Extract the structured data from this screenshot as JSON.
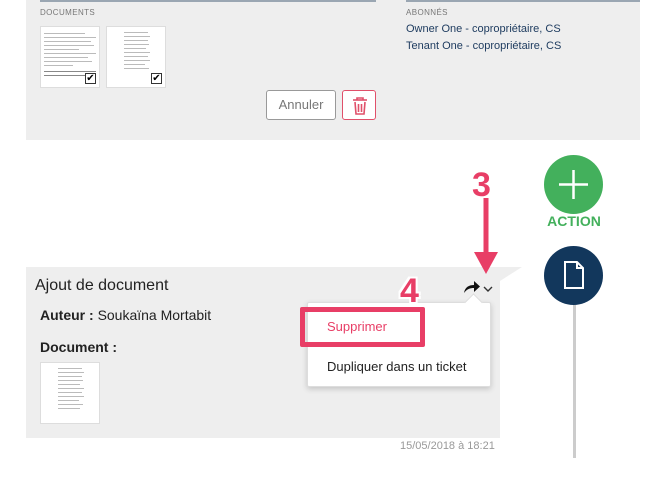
{
  "top_card": {
    "documents_label": "DOCUMENTS",
    "subscribers_label": "ABONNÉS",
    "subscribers": [
      "Owner One - copropriétaire, CS",
      "Tenant One - copropriétaire, CS"
    ],
    "cancel_label": "Annuler",
    "tick_glyph": "✔"
  },
  "timeline": {
    "action_label": "ACTION"
  },
  "event": {
    "title": "Ajout de document",
    "author_label": "Auteur :",
    "author_name": "Soukaïna Mortabit",
    "document_label": "Document :",
    "timestamp": "15/05/2018 à 18:21"
  },
  "dropdown": {
    "delete_label": "Supprimer",
    "duplicate_label": "Dupliquer dans un ticket"
  },
  "annotations": {
    "step_3": "3",
    "step_4": "4"
  },
  "colors": {
    "accent_pink": "#e83e66",
    "action_green": "#43b05c",
    "navy": "#12375c",
    "card_grey": "#eeeeee"
  },
  "icons": {
    "trash": "trash-icon",
    "plus": "plus-icon",
    "document": "document-icon",
    "share": "share-arrow-icon",
    "chevron": "chevron-down-icon"
  }
}
